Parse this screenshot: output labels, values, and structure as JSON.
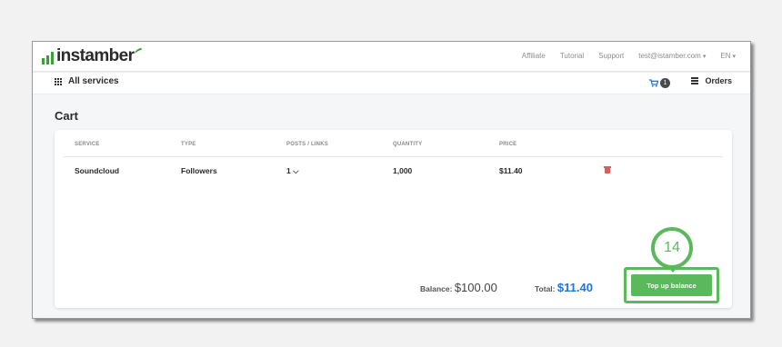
{
  "brand": {
    "name": "instamber",
    "accent_color": "#3aa13a"
  },
  "topnav": {
    "affiliate": "Affiliate",
    "tutorial": "Tutorial",
    "support": "Support",
    "account": "test@istamber.com",
    "language": "EN"
  },
  "subnav": {
    "all_services": "All services",
    "cart_count": "1",
    "orders": "Orders"
  },
  "cart": {
    "title": "Cart",
    "columns": {
      "service": "SERVICE",
      "type": "TYPE",
      "posts": "POSTS / LINKS",
      "quantity": "QUANTITY",
      "price": "PRICE"
    },
    "rows": [
      {
        "service": "Soundcloud",
        "type": "Followers",
        "posts": "1",
        "quantity": "1,000",
        "price": "$11.40"
      }
    ],
    "balance_label": "Balance:",
    "balance_value": "$100.00",
    "total_label": "Total:",
    "total_value": "$11.40",
    "topup_label": "Top up balance"
  },
  "annotation": {
    "step_number": "14",
    "color": "#5cb85c"
  }
}
